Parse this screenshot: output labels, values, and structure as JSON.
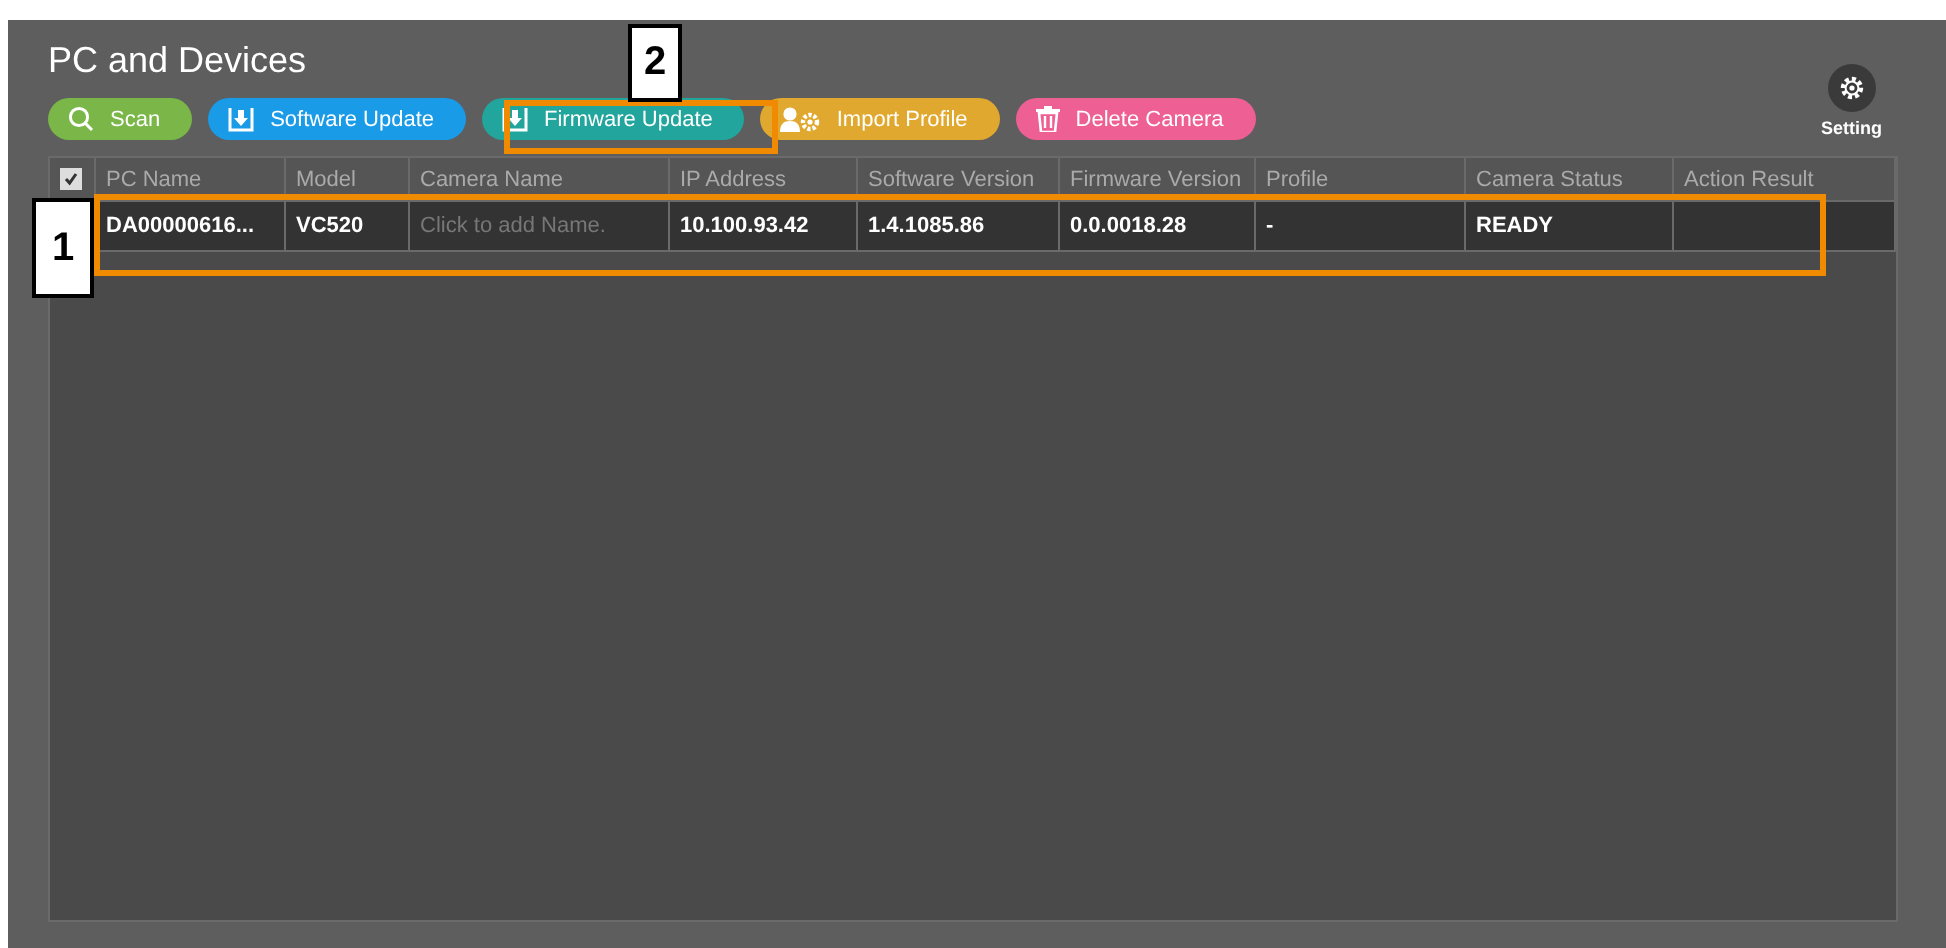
{
  "title": "PC and Devices",
  "toolbar": [
    {
      "label": "Scan",
      "kind": "search",
      "color": "#7ab648"
    },
    {
      "label": "Software Update",
      "kind": "download",
      "color": "#1a9be8"
    },
    {
      "label": "Firmware Update",
      "kind": "download",
      "color": "#22a59c"
    },
    {
      "label": "Import Profile",
      "kind": "profile",
      "color": "#e0a82e"
    },
    {
      "label": "Delete Camera",
      "kind": "trash",
      "color": "#ee5f93"
    }
  ],
  "setting": {
    "label": "Setting"
  },
  "table": {
    "select_all": {
      "checked": true
    },
    "columns": [
      "PC Name",
      "Model",
      "Camera Name",
      "IP Address",
      "Software Version",
      "Firmware Version",
      "Profile",
      "Camera Status",
      "Action Result"
    ],
    "rows": [
      {
        "cells": [
          "DA00000616...",
          "VC520",
          "Click to add Name.",
          "10.100.93.42",
          "1.4.1085.86",
          "0.0.0018.28",
          "-",
          "READY",
          null
        ]
      }
    ]
  },
  "callouts": [
    {
      "label": "1"
    },
    {
      "label": "2"
    }
  ]
}
